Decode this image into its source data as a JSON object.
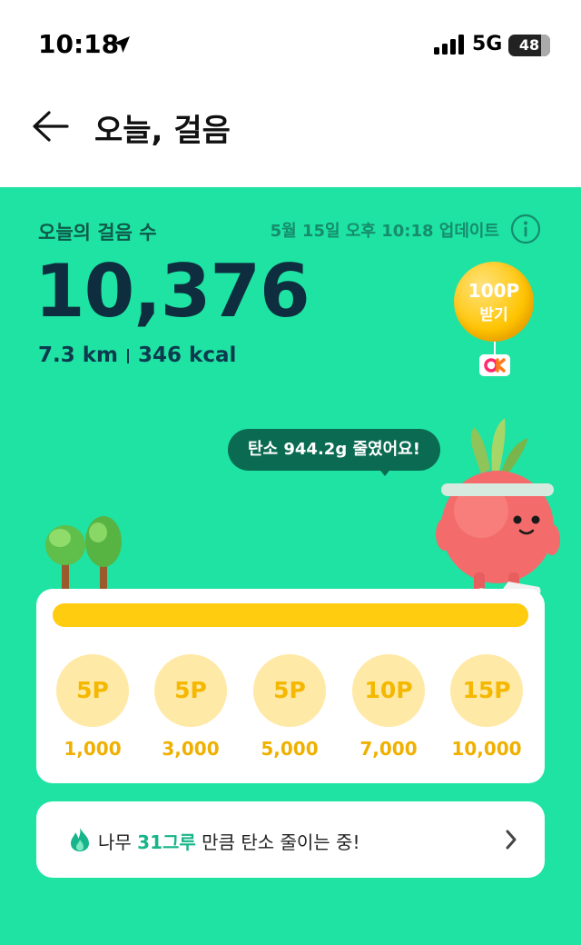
{
  "status_bar": {
    "time": "10:18",
    "network": "5G",
    "battery": "48",
    "icons": [
      "location-arrow-icon",
      "signal-bars-icon",
      "battery-icon"
    ]
  },
  "header": {
    "title": "오늘, 걸음",
    "back_icon": "back-arrow-icon"
  },
  "summary": {
    "label": "오늘의 걸음 수",
    "updated": "5월 15일 오후 10:18 업데이트",
    "info_icon": "info-icon",
    "step_count": "10,376",
    "distance": "7.3 km",
    "calories": "346 kcal"
  },
  "reward": {
    "points": "100P",
    "action": "받기",
    "badge": "OK-logo"
  },
  "carbon_message": "탄소 944.2g 줄였어요!",
  "progress": {
    "fill_ratio": 1.0,
    "milestones": [
      {
        "points": "5P",
        "steps": "1,000"
      },
      {
        "points": "5P",
        "steps": "3,000"
      },
      {
        "points": "5P",
        "steps": "5,000"
      },
      {
        "points": "10P",
        "steps": "7,000"
      },
      {
        "points": "15P",
        "steps": "10,000"
      }
    ]
  },
  "tree_banner": {
    "prefix": "나무 ",
    "count": "31그루",
    "suffix": " 만큼 탄소 줄이는 중!",
    "icon": "flame-icon",
    "chevron": "chevron-right-icon"
  },
  "colors": {
    "panel_green": "#1ee3a3",
    "progress_yellow": "#ffcc10",
    "coin_bg": "#ffe9a6",
    "dark_navy": "#0e2d3e",
    "bubble_green": "#0b6b52"
  }
}
